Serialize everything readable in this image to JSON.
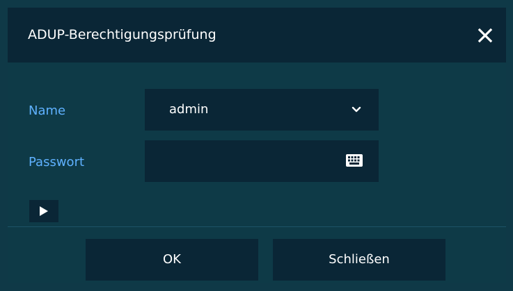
{
  "dialog": {
    "title": "ADUP-Berechtigungsprüfung",
    "close_icon": "close-x-icon"
  },
  "form": {
    "name_label": "Name",
    "name_value": "admin",
    "name_dropdown_icon": "chevron-down-icon",
    "password_label": "Passwort",
    "password_value": "",
    "keyboard_icon": "keyboard-icon",
    "expand_icon": "play-triangle-icon"
  },
  "buttons": {
    "ok_label": "OK",
    "close_label": "Schließen"
  },
  "colors": {
    "background": "#0e3a47",
    "panel": "#0a2636",
    "label_accent": "#5fb1ff",
    "text": "#ffffff"
  }
}
